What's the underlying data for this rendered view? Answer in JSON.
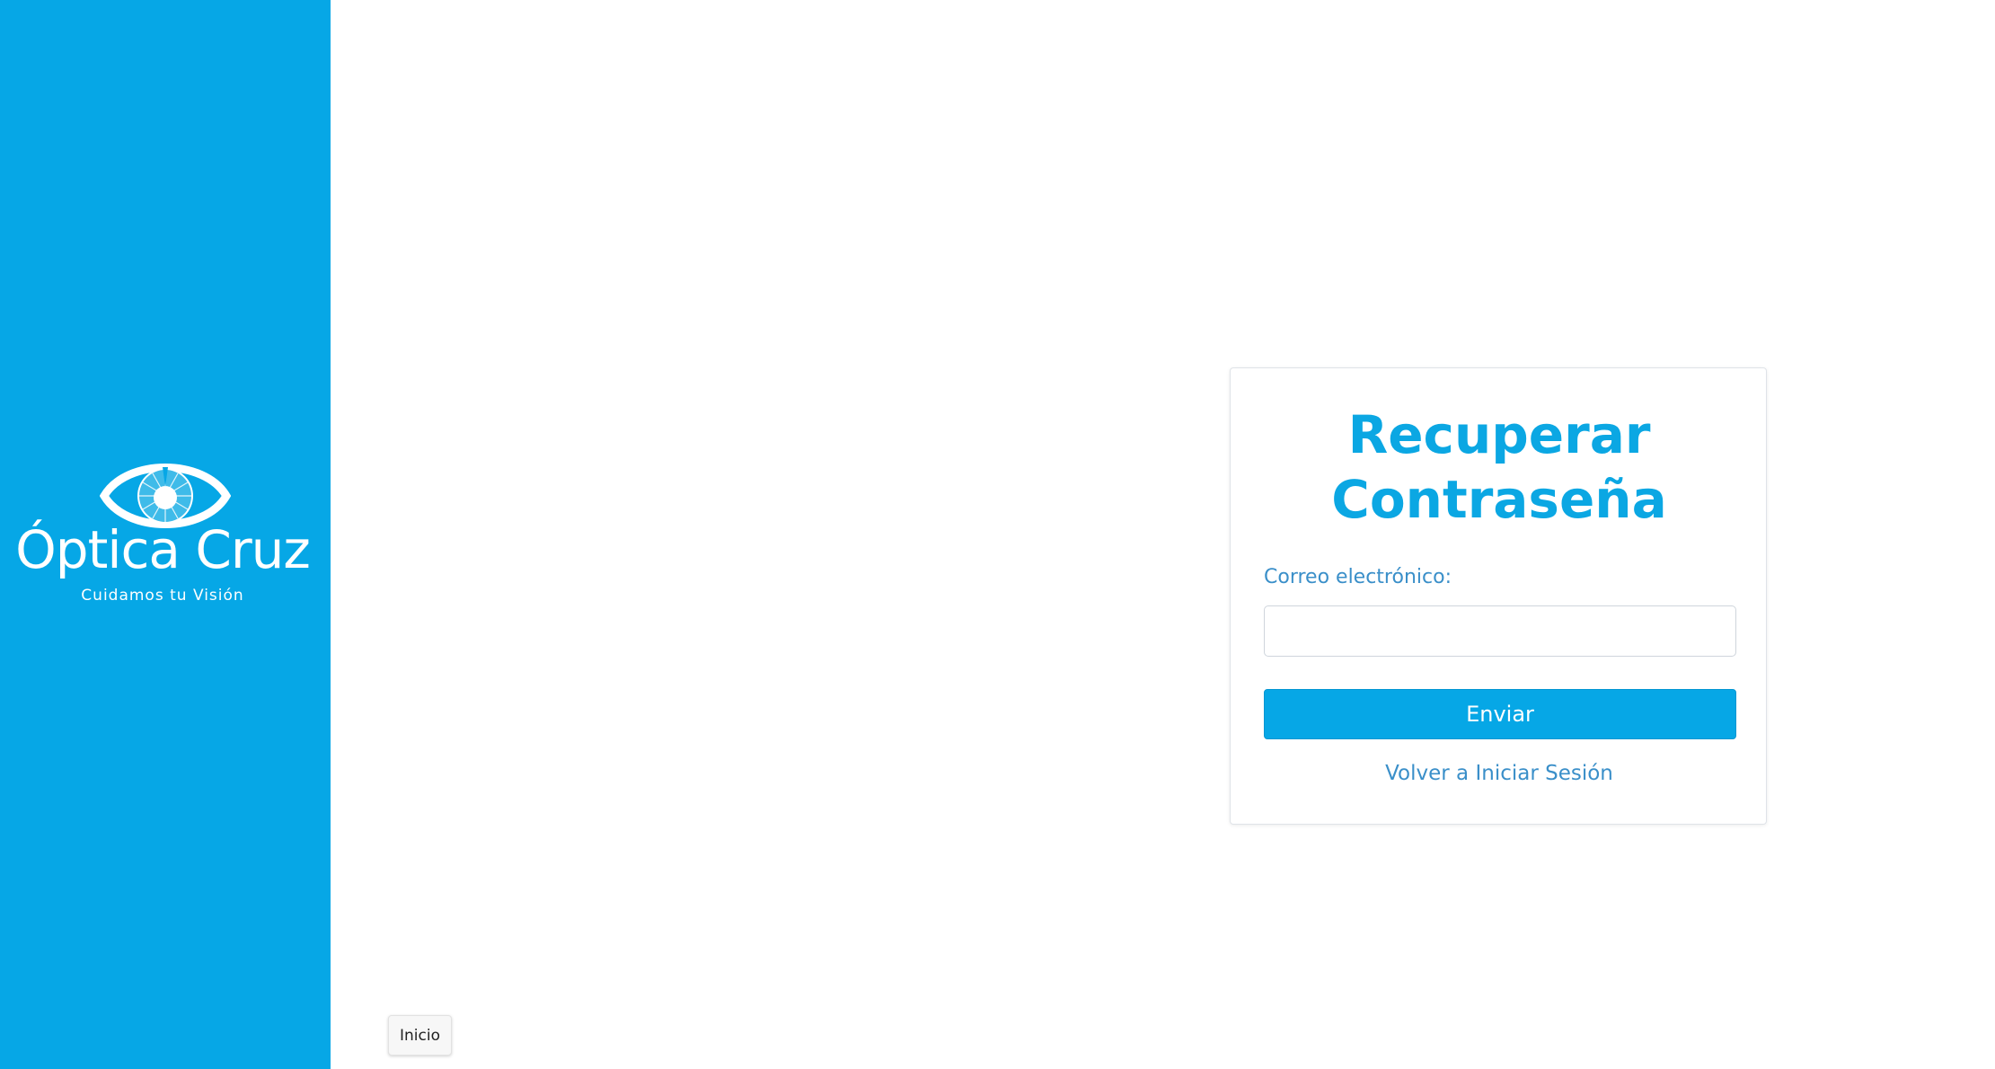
{
  "sidebar": {
    "background_color": "#06a7e6",
    "logo": {
      "icon": "eye-icon",
      "brand_name": "Óptica Cruz",
      "tagline": "Cuidamos tu Visión"
    }
  },
  "card": {
    "title": "Recuperar Contraseña",
    "email_label": "Correo electrónico:",
    "email_value": "",
    "email_placeholder": "",
    "submit_label": "Enviar",
    "back_link_label": "Volver a Iniciar Sesión"
  },
  "footer": {
    "home_button_label": "Inicio"
  },
  "colors": {
    "accent": "#06a7e6",
    "title": "#0ba7e3",
    "link": "#3a8fc9"
  }
}
